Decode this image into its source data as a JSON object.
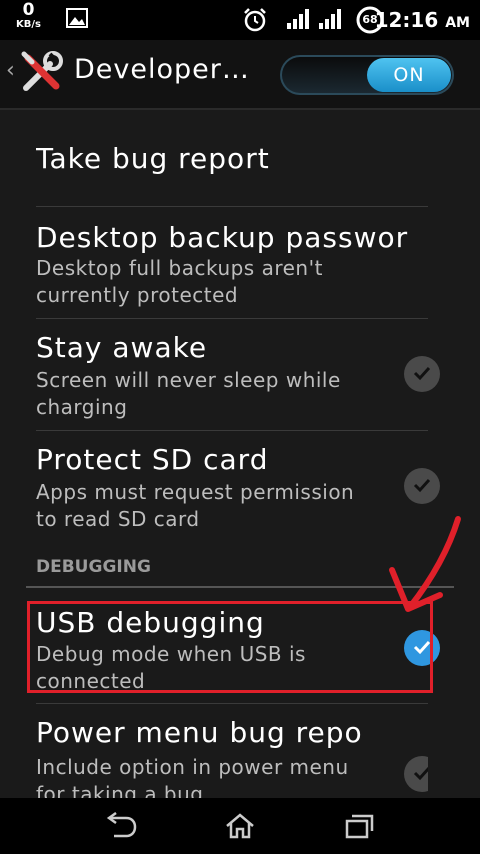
{
  "status_bar": {
    "speed_value": "0",
    "speed_unit": "KB/s",
    "battery_level": "68",
    "time": "12:16",
    "ampm": "AM",
    "icons": [
      "image-icon",
      "alarm-icon",
      "signal-icon",
      "wifi-icon",
      "battery-icon"
    ]
  },
  "action_bar": {
    "title": "Developer…",
    "toggle_label": "ON",
    "accent": "#2f97e0"
  },
  "items": [
    {
      "title": "Take bug report"
    },
    {
      "title": "Desktop backup passwor",
      "subtitle": "Desktop full backups aren't currently protected"
    },
    {
      "title": "Stay awake",
      "subtitle": "Screen will never sleep while charging",
      "checked": true
    },
    {
      "title": "Protect SD card",
      "subtitle": "Apps must request permission to read SD card",
      "checked": true
    },
    {
      "title": "USB debugging",
      "subtitle": "Debug mode when USB is connected",
      "checked": true
    },
    {
      "title": "Power menu bug repo",
      "subtitle": "Include option in power menu for taking a bug",
      "checked": true
    }
  ],
  "section_header": "DEBUGGING",
  "annotation_color": "#e0202a"
}
